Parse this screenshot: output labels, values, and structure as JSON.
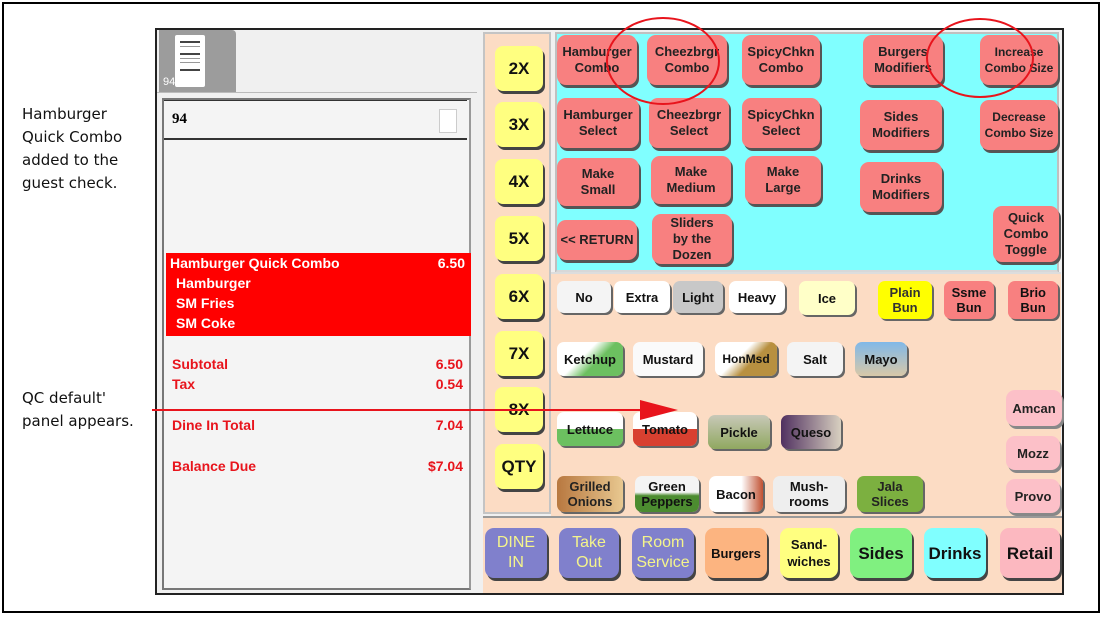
{
  "annotations": {
    "top": "Hamburger Quick Combo added to the guest check.",
    "bottom": "QC default' panel appears."
  },
  "check_tab": {
    "number": "94"
  },
  "check": {
    "number": "94",
    "item": {
      "name": "Hamburger Quick Combo",
      "price": "6.50",
      "components": [
        "Hamburger",
        "SM Fries",
        "SM Coke"
      ]
    },
    "subtotal": {
      "label": "Subtotal",
      "value": "6.50"
    },
    "tax": {
      "label": "Tax",
      "value": "0.54"
    },
    "total": {
      "label": "Dine In Total",
      "value": "7.04"
    },
    "balance": {
      "label": "Balance Due",
      "value": "$7.04"
    }
  },
  "multipliers": [
    "2X",
    "3X",
    "4X",
    "5X",
    "6X",
    "7X",
    "8X",
    "QTY"
  ],
  "combo_buttons": {
    "hamburger_combo": "Hamburger\nCombo",
    "cheezbrgr_combo": "Cheezbrgr\nCombo",
    "spicychkn_combo": "SpicyChkn\nCombo",
    "burgers_modifiers": "Burgers\nModifiers",
    "increase_combo_size": "Increase\nCombo Size",
    "hamburger_select": "Hamburger\nSelect",
    "cheezbrgr_select": "Cheezbrgr\nSelect",
    "spicychkn_select": "SpicyChkn\nSelect",
    "sides_modifiers": "Sides\nModifiers",
    "decrease_combo_size": "Decrease\nCombo Size",
    "make_small": "Make\nSmall",
    "make_medium": "Make\nMedium",
    "make_large": "Make\nLarge",
    "drinks_modifiers": "Drinks\nModifiers",
    "return": "<< RETURN",
    "sliders": "Sliders\nby the\nDozen",
    "quick_combo_toggle": "Quick\nCombo\nToggle"
  },
  "modifiers": {
    "qualifiers": [
      "No",
      "Extra",
      "Light",
      "Heavy",
      "Ice"
    ],
    "buns": [
      "Plain\nBun",
      "Ssme\nBun",
      "Brio\nBun"
    ],
    "condiments": [
      "Ketchup",
      "Mustard",
      "HonMsd",
      "Salt",
      "Mayo"
    ],
    "toppings": [
      "Lettuce",
      "Tomato",
      "Pickle",
      "Queso"
    ],
    "extras": [
      "Grilled\nOnions",
      "Green\nPeppers",
      "Bacon",
      "Mush-\nrooms",
      "Jala\nSlices"
    ],
    "cheeses": [
      "Amcan",
      "Mozz",
      "Provo"
    ]
  },
  "nav": {
    "dine_in": "DINE\nIN",
    "take_out": "Take\nOut",
    "room_service": "Room\nService",
    "burgers": "Burgers",
    "sandwiches": "Sand-\nwiches",
    "sides": "Sides",
    "drinks": "Drinks",
    "retail": "Retail"
  },
  "colors": {
    "accent_red": "#e8141c",
    "combo_button": "#f88080",
    "multiplier": "#ffff80",
    "panel_cyan": "#80ffff",
    "panel_peach": "#fcdcc4"
  }
}
